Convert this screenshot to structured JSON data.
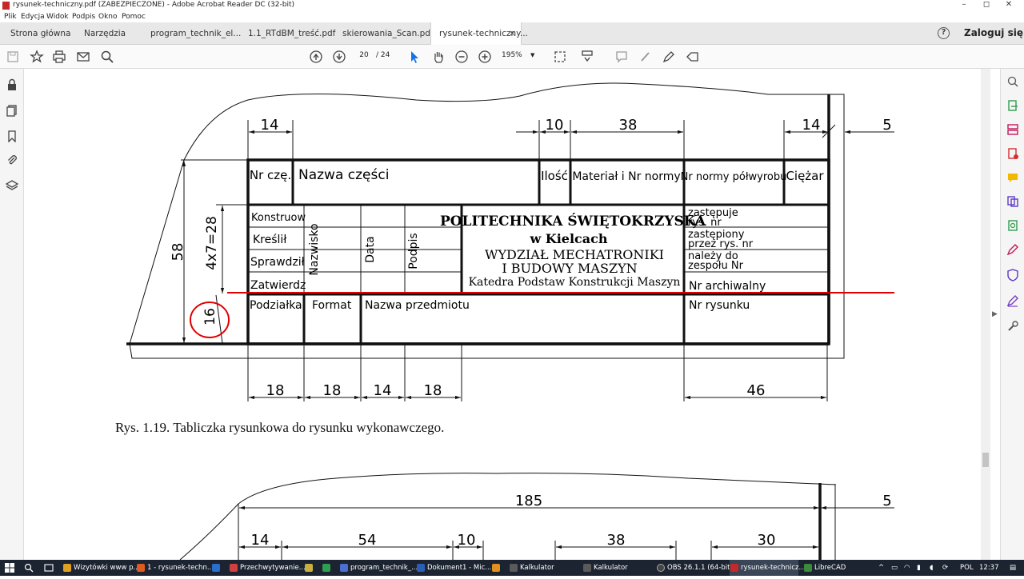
{
  "window": {
    "title": "rysunek-techniczny.pdf (ZABEZPIECZONE) - Adobe Acrobat Reader DC (32-bit)",
    "controls": [
      "–",
      "◻",
      "✕"
    ]
  },
  "menu": [
    "Plik",
    "Edycja",
    "Widok",
    "Podpis",
    "Okno",
    "Pomoc"
  ],
  "tabs": {
    "home": "Strona główna",
    "tools": "Narzędzia",
    "docs": [
      {
        "label": "program_technik_el..."
      },
      {
        "label": "1.1_RTdBM_treść.pdf"
      },
      {
        "label": "skierowania_Scan.pdf"
      },
      {
        "label": "rysunek-techniczny..."
      }
    ],
    "close": "×",
    "login": "Zaloguj się",
    "help": "?"
  },
  "toolbar": {
    "page_current": "20",
    "page_total": "/ 24",
    "zoom": "195%"
  },
  "drawing1": {
    "dims_top": [
      "14",
      "10",
      "38",
      "14",
      "5"
    ],
    "dims_left": [
      "58",
      "4x7=28",
      "16"
    ],
    "dims_bottom": [
      "18",
      "18",
      "14",
      "18",
      "46"
    ],
    "header": [
      "Nr czę.",
      "Nazwa części",
      "Ilość",
      "Materiał i Nr normy",
      "Nr normy półwyrobu",
      "Ciężar"
    ],
    "rows": [
      "Konstruow",
      "Kreślił",
      "Sprawdził",
      "Zatwierdz"
    ],
    "vertical": [
      "Nazwisko",
      "Data",
      "Podpis"
    ],
    "school": [
      "POLITECHNIKA ŚWIĘTOKRZYSKA",
      "w Kielcach",
      "WYDZIAŁ MECHATRONIKI",
      "I BUDOWY MASZYN",
      "Katedra Podstaw Konstrukcji Maszyn"
    ],
    "right_rows": [
      "zastępuje",
      "rys. nr",
      "zastępiony",
      "przez rys. nr",
      "należy do",
      "zespołu Nr",
      "Nr archiwalny"
    ],
    "bottom": [
      "Podziałka",
      "Format",
      "Nazwa przedmiotu",
      "Nr rysunku"
    ]
  },
  "caption": "Rys. 1.19. Tabliczka rysunkowa do rysunku wykonawczego.",
  "drawing2": {
    "dims_top": [
      "185",
      "5"
    ],
    "dims_row": [
      "14",
      "54",
      "10",
      "38",
      "30"
    ]
  },
  "taskbar": {
    "tasks": [
      {
        "label": "Wizytówki www p...",
        "color": "#e0a020"
      },
      {
        "label": "1 - rysunek-techn...",
        "color": "#e05a20"
      },
      {
        "label": "",
        "color": "#2a6fc9"
      },
      {
        "label": "Przechwytywanie...",
        "color": "#d04040"
      },
      {
        "label": "",
        "color": "#c8b040"
      },
      {
        "label": "",
        "color": "#2e9e4f"
      },
      {
        "label": "program_technik_...",
        "color": "#4a6fd0"
      },
      {
        "label": "Dokument1 - Mic...",
        "color": "#2b5fb4"
      },
      {
        "label": "",
        "color": "#e09020"
      },
      {
        "label": "Kalkulator",
        "color": "#5a5a5a"
      },
      {
        "label": "Kalkulator",
        "color": "#5a5a5a"
      },
      {
        "label": "OBS 26.1.1 (64-bit...",
        "color": "#444"
      },
      {
        "label": "rysunek-technicz...",
        "color": "#c62828"
      },
      {
        "label": "LibreCAD",
        "color": "#3c8a3c"
      }
    ],
    "lang": "POL",
    "time": "12:37"
  },
  "colors": {
    "annotation_red": "#e00000",
    "accent": "#1473e6"
  }
}
